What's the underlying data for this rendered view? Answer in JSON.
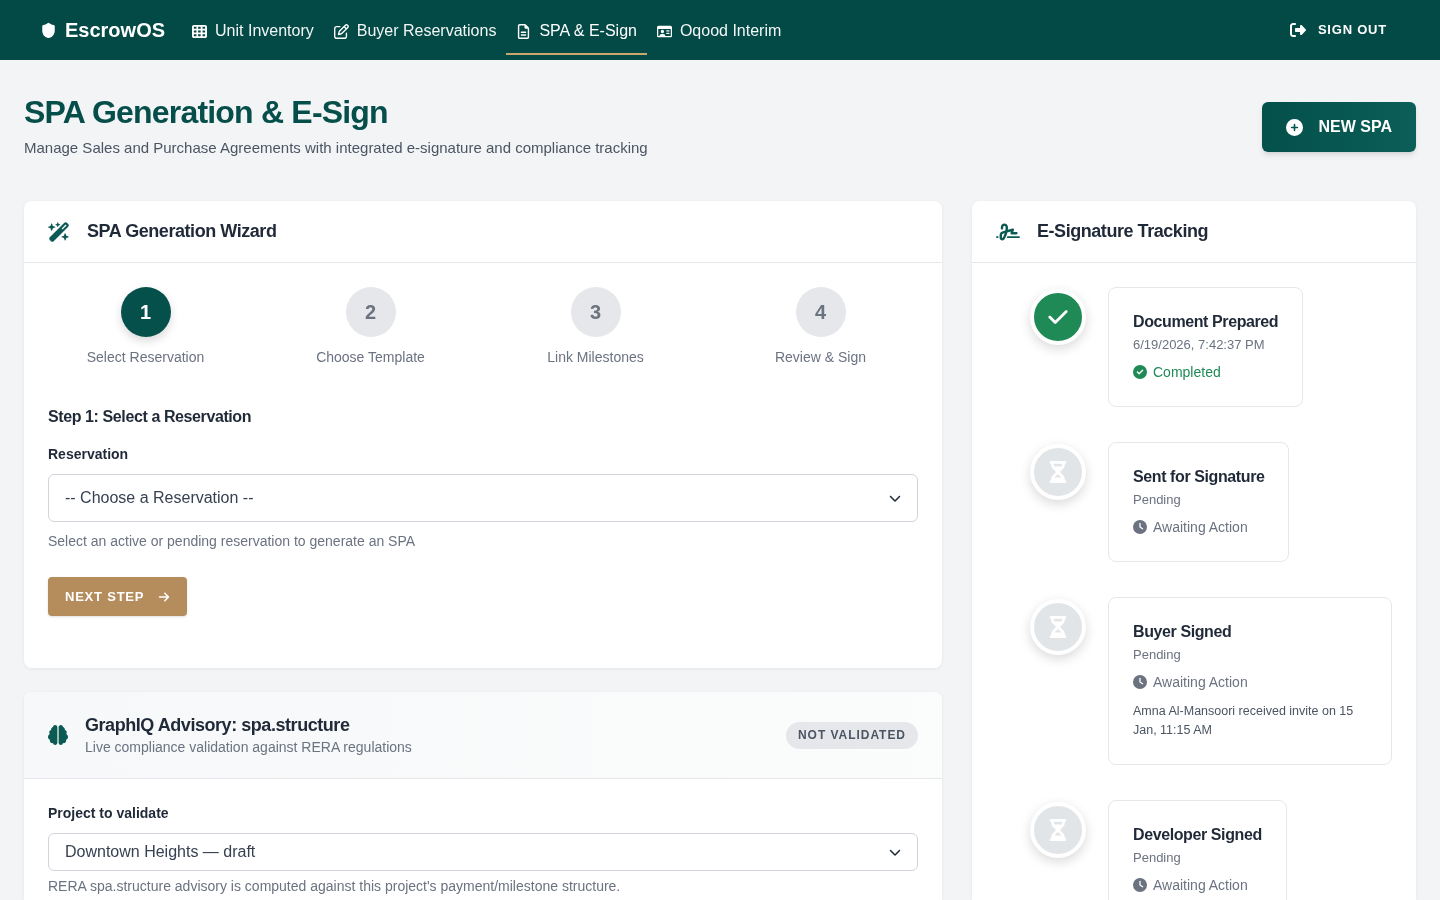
{
  "nav": {
    "brand": "EscrowOS",
    "items": [
      {
        "label": "Unit Inventory",
        "selected": false
      },
      {
        "label": "Buyer Reservations",
        "selected": false
      },
      {
        "label": "SPA & E-Sign",
        "selected": true
      },
      {
        "label": "Oqood Interim",
        "selected": false
      }
    ],
    "sign_out": "SIGN OUT"
  },
  "header": {
    "title": "SPA Generation & E-Sign",
    "subtitle": "Manage Sales and Purchase Agreements with integrated e-signature and compliance tracking",
    "new_button": "NEW SPA"
  },
  "wizard": {
    "title": "SPA Generation Wizard",
    "steps": [
      {
        "number": "1",
        "label": "Select Reservation",
        "selected": true
      },
      {
        "number": "2",
        "label": "Choose Template",
        "selected": false
      },
      {
        "number": "3",
        "label": "Link Milestones",
        "selected": false
      },
      {
        "number": "4",
        "label": "Review & Sign",
        "selected": false
      }
    ],
    "step_heading": "Step 1: Select a Reservation",
    "field_label": "Reservation",
    "select": {
      "value": "-- Choose a Reservation --"
    },
    "help": "Select an active or pending reservation to generate an SPA",
    "next_button": "NEXT STEP"
  },
  "advisory": {
    "title": "GraphIQ Advisory: spa.structure",
    "subtitle": "Live compliance validation against RERA regulations",
    "badge": "NOT VALIDATED",
    "field_label": "Project to validate",
    "select": {
      "value": "Downtown Heights — draft"
    },
    "help": "RERA spa.structure advisory is computed against this project's payment/milestone structure."
  },
  "tracking": {
    "title": "E-Signature Tracking",
    "events": [
      {
        "title": "Document Prepared",
        "detail": "6/19/2026, 7:42:37 PM",
        "status": "Completed",
        "completed": true
      },
      {
        "title": "Sent for Signature",
        "detail": "Pending",
        "status": "Awaiting Action",
        "completed": false
      },
      {
        "title": "Buyer Signed",
        "detail": "Pending",
        "status": "Awaiting Action",
        "completed": false,
        "note": "Amna Al-Mansoori received invite on 15 Jan, 11:15 AM"
      },
      {
        "title": "Developer Signed",
        "detail": "Pending",
        "status": "Awaiting Action",
        "completed": false
      }
    ]
  }
}
